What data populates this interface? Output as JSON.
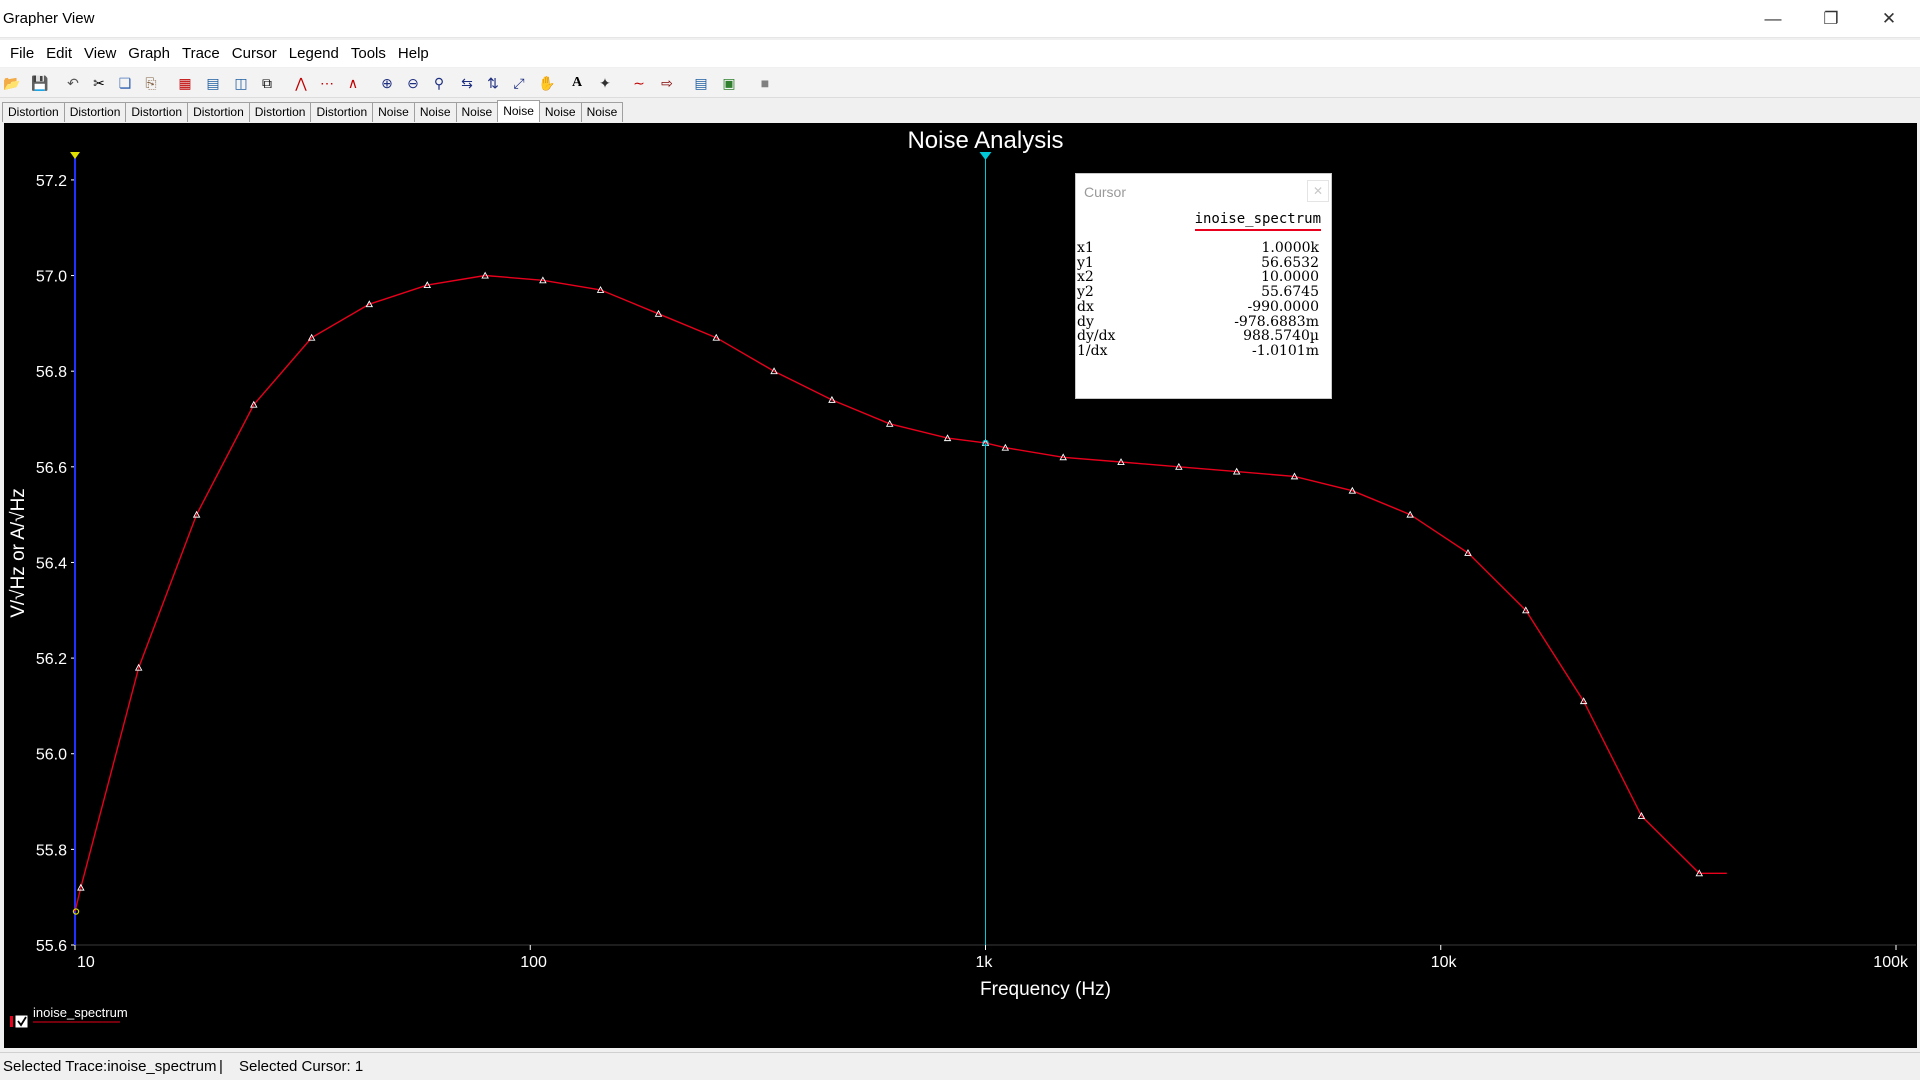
{
  "window": {
    "title": "Grapher View"
  },
  "menu": [
    "File",
    "Edit",
    "View",
    "Graph",
    "Trace",
    "Cursor",
    "Legend",
    "Tools",
    "Help"
  ],
  "toolbar_icons": [
    "open-icon",
    "save-icon",
    "undo-icon",
    "cut-icon",
    "copy-icon",
    "paste-icon",
    "grid-icon",
    "legend-icon",
    "cursor-icon",
    "overlay-icon",
    "line-trace-icon",
    "dot-trace-icon",
    "line-dot-trace-icon",
    "zoom-in-icon",
    "zoom-out-icon",
    "zoom-full-icon",
    "zoom-x-icon",
    "zoom-y-icon",
    "zoom-xy-icon",
    "pan-icon",
    "text-icon",
    "label-icon",
    "merge-traces-icon",
    "export-icon",
    "copy-graph-icon",
    "properties-icon",
    "stop-icon"
  ],
  "tabs": [
    {
      "label": "Distortion",
      "active": false
    },
    {
      "label": "Distortion",
      "active": false
    },
    {
      "label": "Distortion",
      "active": false
    },
    {
      "label": "Distortion",
      "active": false
    },
    {
      "label": "Distortion",
      "active": false
    },
    {
      "label": "Distortion",
      "active": false
    },
    {
      "label": "Noise",
      "active": false
    },
    {
      "label": "Noise",
      "active": false
    },
    {
      "label": "Noise",
      "active": false
    },
    {
      "label": "Noise",
      "active": true
    },
    {
      "label": "Noise",
      "active": false
    },
    {
      "label": "Noise",
      "active": false
    }
  ],
  "colors": {
    "plot_bg": "#000000",
    "trace": "#e8001c",
    "cursor1": "#00c8d8",
    "cursor2": "#2030ff",
    "cursor2_marker": "#e0e000",
    "axis_text": "#ffffff"
  },
  "cursor_panel": {
    "title": "Cursor",
    "trace_name": "inoise_spectrum",
    "rows": [
      {
        "key": "x1",
        "value": "1.0000k"
      },
      {
        "key": "y1",
        "value": "56.6532"
      },
      {
        "key": "x2",
        "value": "10.0000"
      },
      {
        "key": "y2",
        "value": "55.6745"
      },
      {
        "key": "dx",
        "value": "-990.0000"
      },
      {
        "key": "dy",
        "value": "-978.6883m"
      },
      {
        "key": "dy/dx",
        "value": "988.5740µ"
      },
      {
        "key": "1/dx",
        "value": "-1.0101m"
      }
    ]
  },
  "status": {
    "selected_trace": "Selected Trace:inoise_spectrum",
    "separator": "|",
    "selected_cursor": "Selected Cursor: 1"
  },
  "chart_data": {
    "type": "line",
    "title": "Noise Analysis",
    "xlabel": "Frequency (Hz)",
    "ylabel": "V/√Hz or A/√Hz",
    "xscale": "log",
    "xlim": [
      10,
      100000
    ],
    "ylim": [
      55.6,
      57.25
    ],
    "x_ticks": [
      10,
      100,
      1000,
      10000,
      100000
    ],
    "x_tick_labels": [
      "10",
      "100",
      "1k",
      "10k",
      "100k"
    ],
    "y_ticks": [
      55.6,
      55.8,
      56.0,
      56.2,
      56.4,
      56.6,
      56.8,
      57.0,
      57.2
    ],
    "y_tick_labels": [
      "55.6",
      "55.8",
      "56.0",
      "56.2",
      "56.4",
      "56.6",
      "56.8",
      "57.0",
      "57.2"
    ],
    "grid": false,
    "legend": "bottom-left",
    "cursors": [
      {
        "name": "cursor-1",
        "x": 1000
      },
      {
        "name": "cursor-2",
        "x": 10
      }
    ],
    "series": [
      {
        "name": "inoise_spectrum",
        "x": [
          10,
          10.3,
          13.8,
          18.5,
          24.7,
          33.1,
          44.3,
          59.4,
          79.6,
          106.6,
          142.7,
          191.3,
          256.2,
          343.2,
          459.9,
          616.0,
          825.3,
          1000,
          1105.6,
          1481.4,
          1984.6,
          2658.9,
          3562.3,
          4772.4,
          6394.1,
          8566.6,
          11476.5,
          15375.8,
          20599.9,
          27598.9,
          36973.8,
          42500
        ],
        "y": [
          55.67,
          55.72,
          56.18,
          56.5,
          56.73,
          56.87,
          56.94,
          56.98,
          57.0,
          56.99,
          56.97,
          56.92,
          56.87,
          56.8,
          56.74,
          56.69,
          56.66,
          56.65,
          56.64,
          56.62,
          56.61,
          56.6,
          56.59,
          56.58,
          56.55,
          56.5,
          56.42,
          56.3,
          56.11,
          55.87,
          55.75,
          55.75
        ]
      }
    ]
  }
}
